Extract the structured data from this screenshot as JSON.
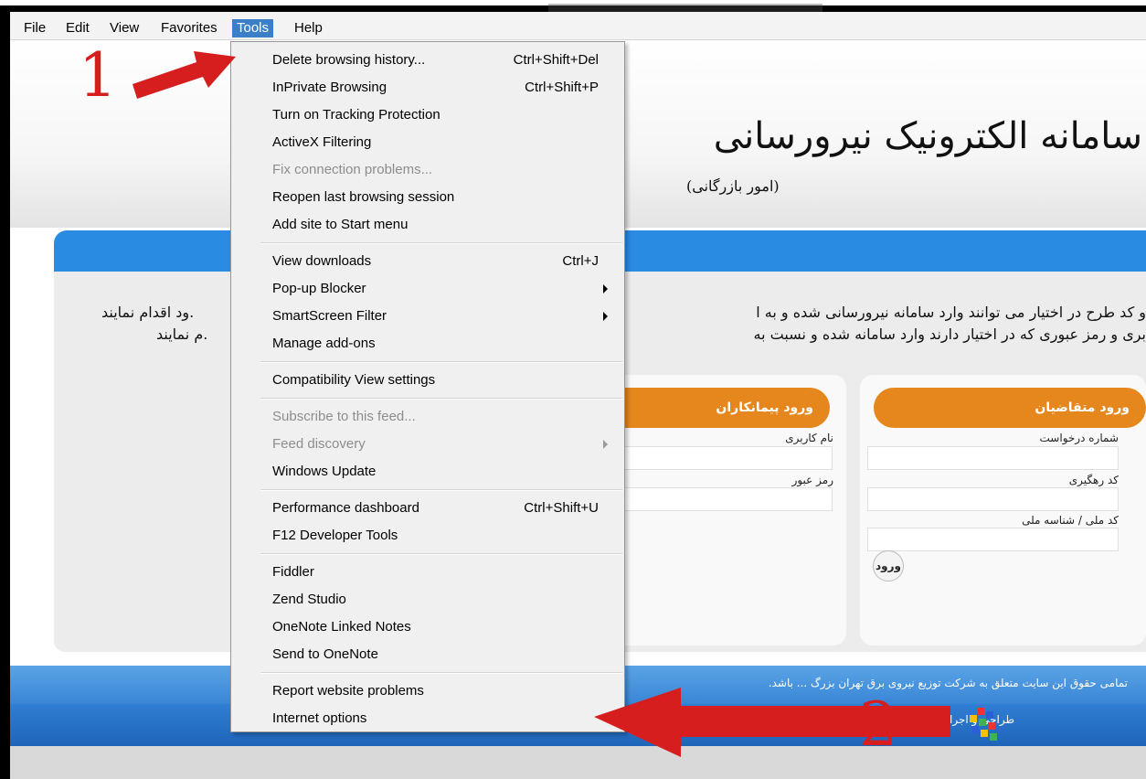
{
  "menubar": {
    "items": [
      "File",
      "Edit",
      "View",
      "Favorites",
      "Tools",
      "Help"
    ]
  },
  "tools_menu": {
    "groups": [
      [
        {
          "label": "Delete browsing history...",
          "shortcut": "Ctrl+Shift+Del"
        },
        {
          "label": "InPrivate Browsing",
          "shortcut": "Ctrl+Shift+P"
        },
        {
          "label": "Turn on Tracking Protection",
          "shortcut": ""
        },
        {
          "label": "ActiveX Filtering",
          "shortcut": ""
        },
        {
          "label": "Fix connection problems...",
          "shortcut": "",
          "disabled": true
        },
        {
          "label": "Reopen last browsing session",
          "shortcut": ""
        },
        {
          "label": "Add site to Start menu",
          "shortcut": ""
        }
      ],
      [
        {
          "label": "View downloads",
          "shortcut": "Ctrl+J"
        },
        {
          "label": "Pop-up Blocker",
          "shortcut": "",
          "submenu": true
        },
        {
          "label": "SmartScreen Filter",
          "shortcut": "",
          "submenu": true
        },
        {
          "label": "Manage add-ons",
          "shortcut": ""
        }
      ],
      [
        {
          "label": "Compatibility View settings",
          "shortcut": ""
        }
      ],
      [
        {
          "label": "Subscribe to this feed...",
          "shortcut": "",
          "disabled": true
        },
        {
          "label": "Feed discovery",
          "shortcut": "",
          "disabled": true,
          "submenu": true
        },
        {
          "label": "Windows Update",
          "shortcut": ""
        }
      ],
      [
        {
          "label": "Performance dashboard",
          "shortcut": "Ctrl+Shift+U"
        },
        {
          "label": "F12 Developer Tools",
          "shortcut": ""
        }
      ],
      [
        {
          "label": "Fiddler",
          "shortcut": ""
        },
        {
          "label": "Zend Studio",
          "shortcut": ""
        },
        {
          "label": "OneNote Linked Notes",
          "shortcut": ""
        },
        {
          "label": "Send to OneNote",
          "shortcut": ""
        }
      ],
      [
        {
          "label": "Report website problems",
          "shortcut": ""
        },
        {
          "label": "Internet options",
          "shortcut": ""
        }
      ]
    ]
  },
  "page": {
    "title": "سامانه الکترونیک نیرورسانی",
    "subtitle": "(امور بازرگانی)",
    "intro_line1": "و کد طرح در اختیار می توانند وارد سامانه نیرورسانی شده و به ا",
    "intro_line2": "بری و رمز عبوری که در اختیار دارند وارد سامانه شده و نسبت به",
    "left_line1": "ود اقدام نمایند.",
    "left_line2": "م نمایند.",
    "applicants": {
      "title": "ورود متقاضیان",
      "field1": "شماره درخواست",
      "field2": "کد رهگیری",
      "field3": "کد ملی / شناسه ملی",
      "button": "ورود"
    },
    "contractors": {
      "title": "ورود پیمانکاران",
      "username": "نام کاربری",
      "password": "رمز عبور"
    },
    "footer_copyright": "تمامی حقوق این سایت متعلق به شرکت توزیع نیروی برق تهران بزرگ ... باشد.",
    "footer_design": "طراحی و اجرا توس"
  },
  "annotations": {
    "step1": "1",
    "step2": "2",
    "color": "#d71e1e"
  },
  "colors": {
    "accent_orange": "#e6871e",
    "accent_blue": "#2a8be3",
    "menu_highlight": "#3b7fc9"
  }
}
